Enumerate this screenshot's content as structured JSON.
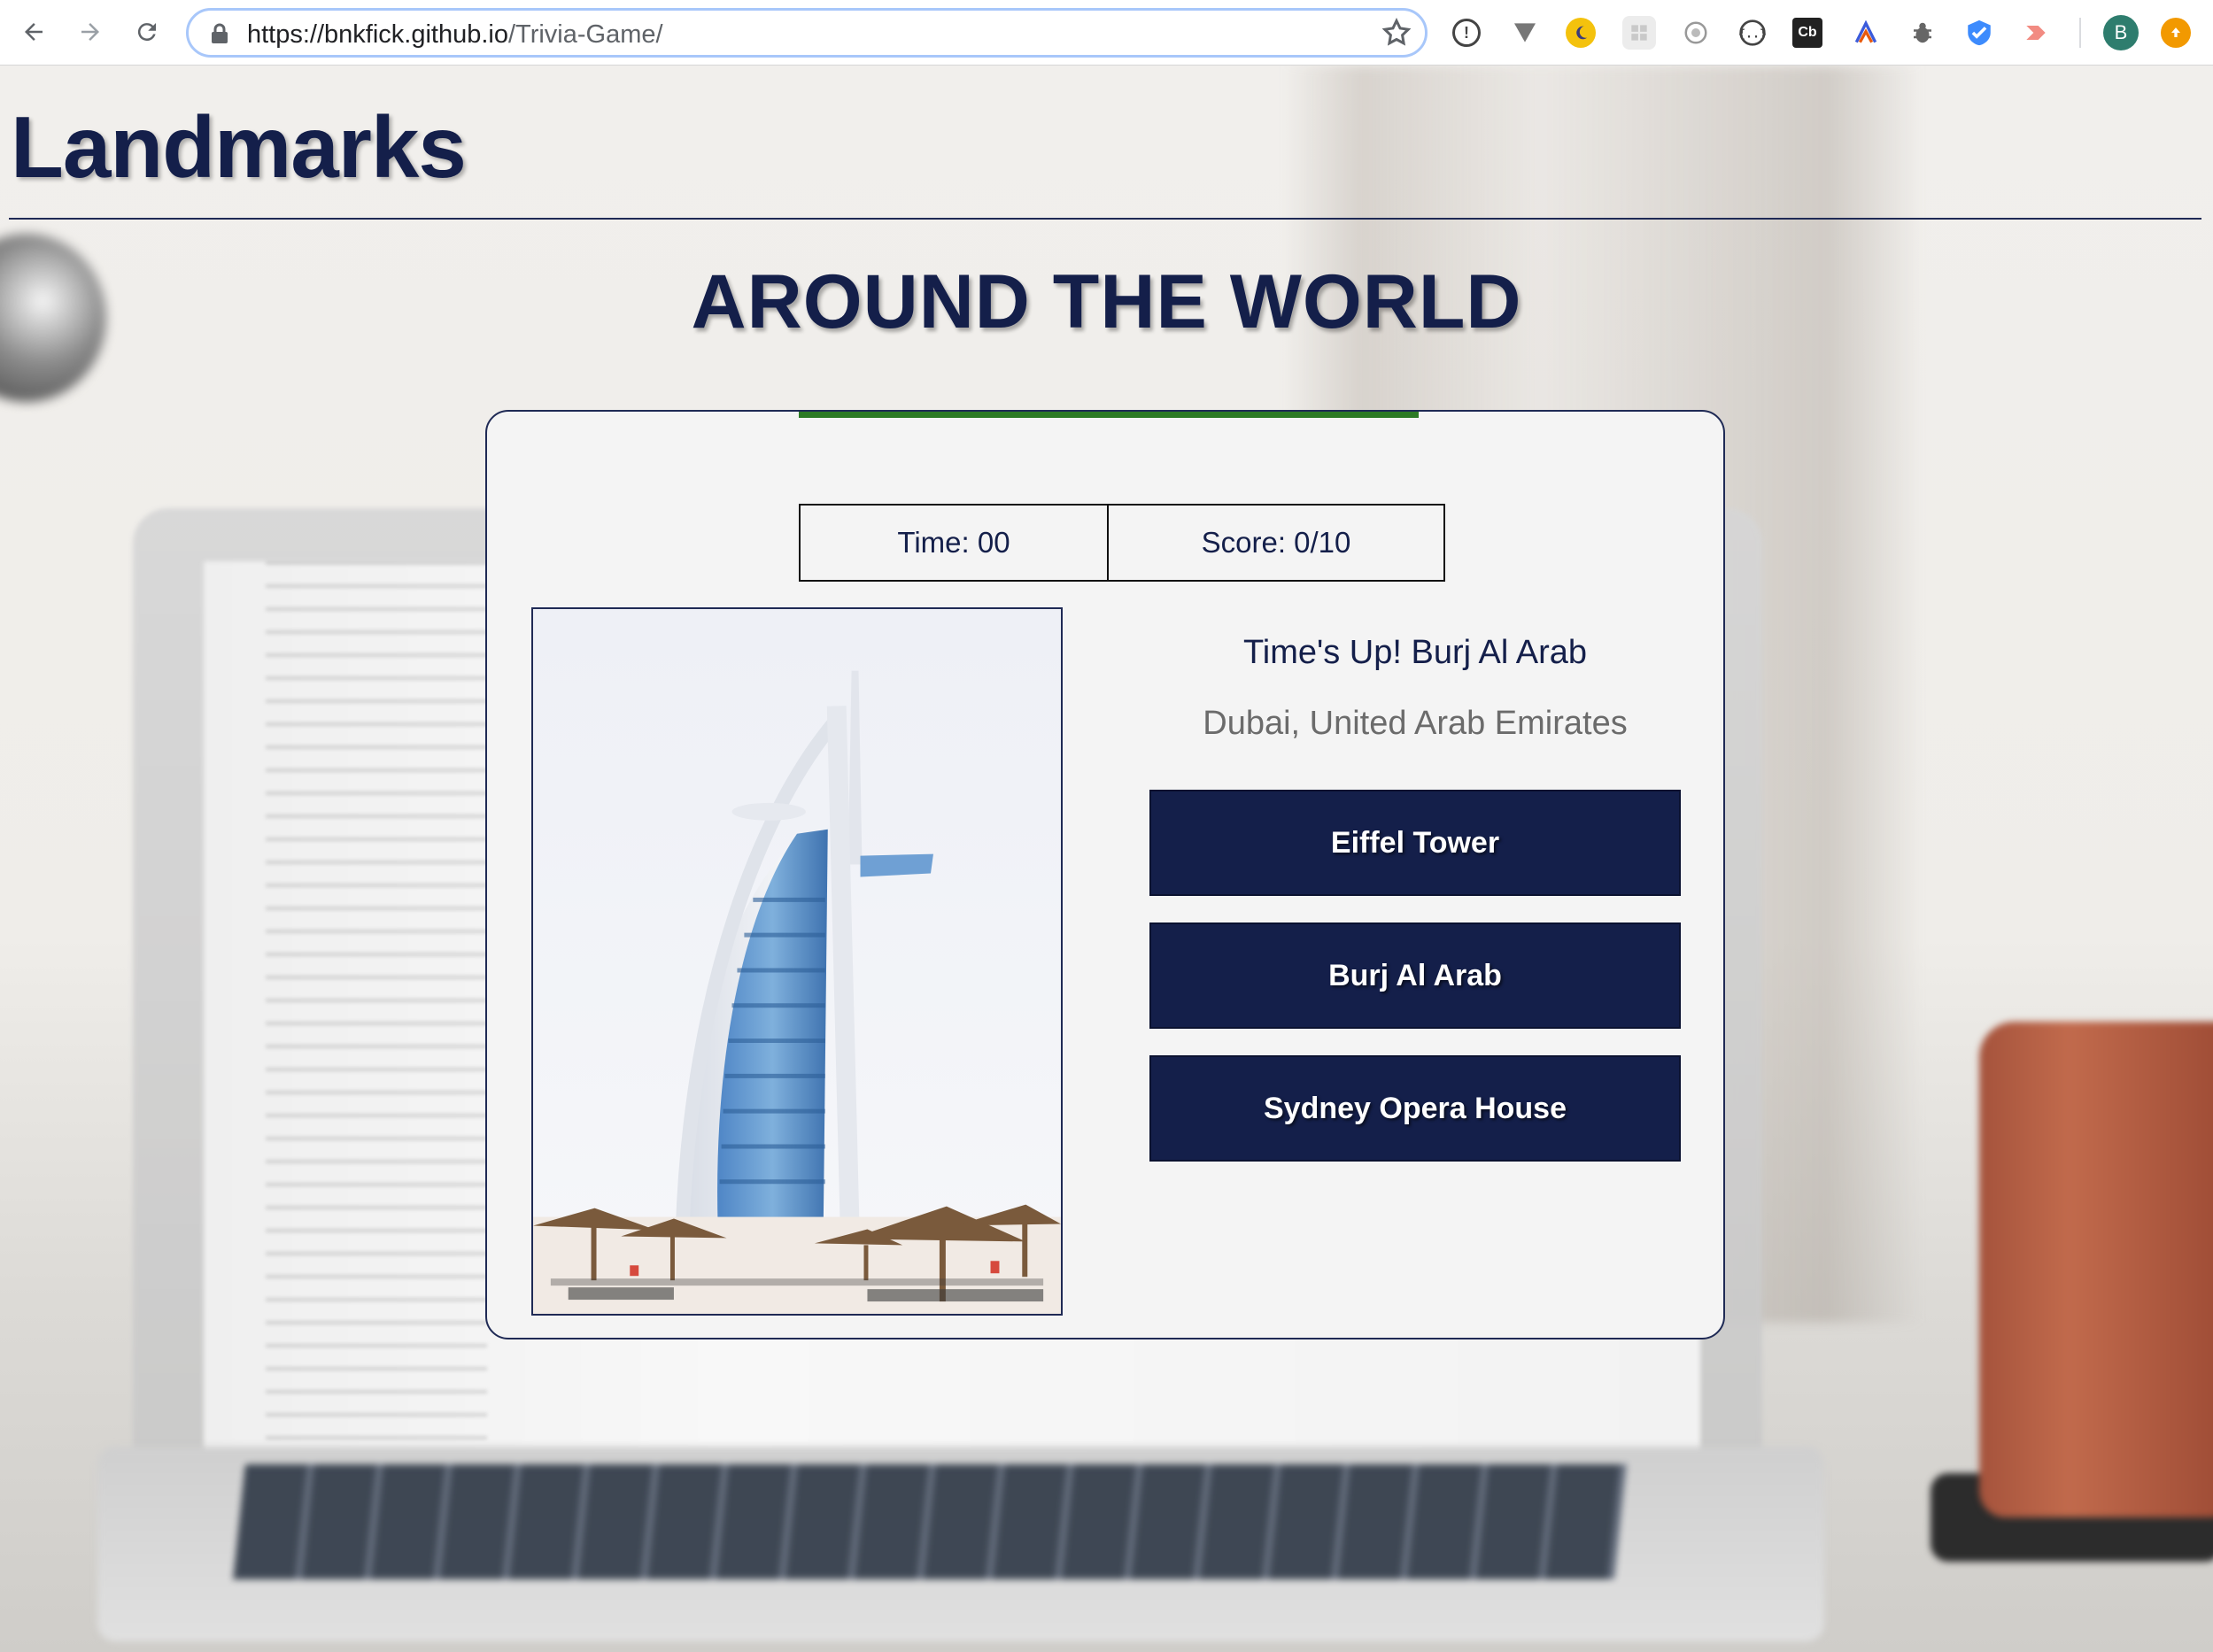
{
  "browser": {
    "url_host": "https://bnkfick.github.io",
    "url_path": "/Trivia-Game/",
    "profile_initial": "B",
    "extension_cb_label": "Cb",
    "extensions": [
      "info-icon",
      "vee-icon",
      "moon-icon",
      "grid-icon",
      "camera-icon",
      "braces-icon",
      "cb-icon",
      "chart-icon",
      "bug-icon",
      "shield-check-icon",
      "arrow-icon"
    ]
  },
  "header": {
    "site_title": "Landmarks",
    "headline": "AROUND THE WORLD"
  },
  "game": {
    "progress_fraction": 1.0,
    "progress_color": "#2c7a24",
    "time_label": "Time: 00",
    "score_label": "Score: 0/10",
    "result_text": "Time's Up! Burj Al Arab",
    "location_text": "Dubai, United Arab Emirates",
    "choices": [
      "Eiffel Tower",
      "Burj Al Arab",
      "Sydney Opera House"
    ],
    "accent_color": "#141f4a"
  }
}
